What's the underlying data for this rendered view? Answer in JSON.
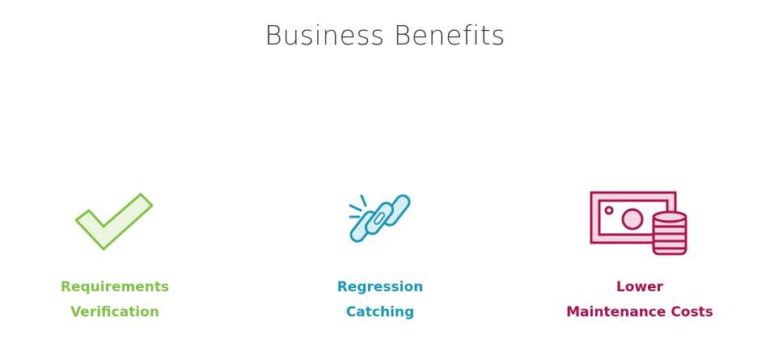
{
  "title": "Business Benefits",
  "benefits": [
    {
      "icon": "checkmark-icon",
      "line1": "Requirements",
      "line2": "Verification",
      "color": "#7dc242"
    },
    {
      "icon": "broken-chain-link-icon",
      "line1": "Regression",
      "line2": "Catching",
      "color": "#1b95b8"
    },
    {
      "icon": "money-coins-icon",
      "line1": "Lower",
      "line2": "Maintenance Costs",
      "color": "#a8114e"
    }
  ]
}
